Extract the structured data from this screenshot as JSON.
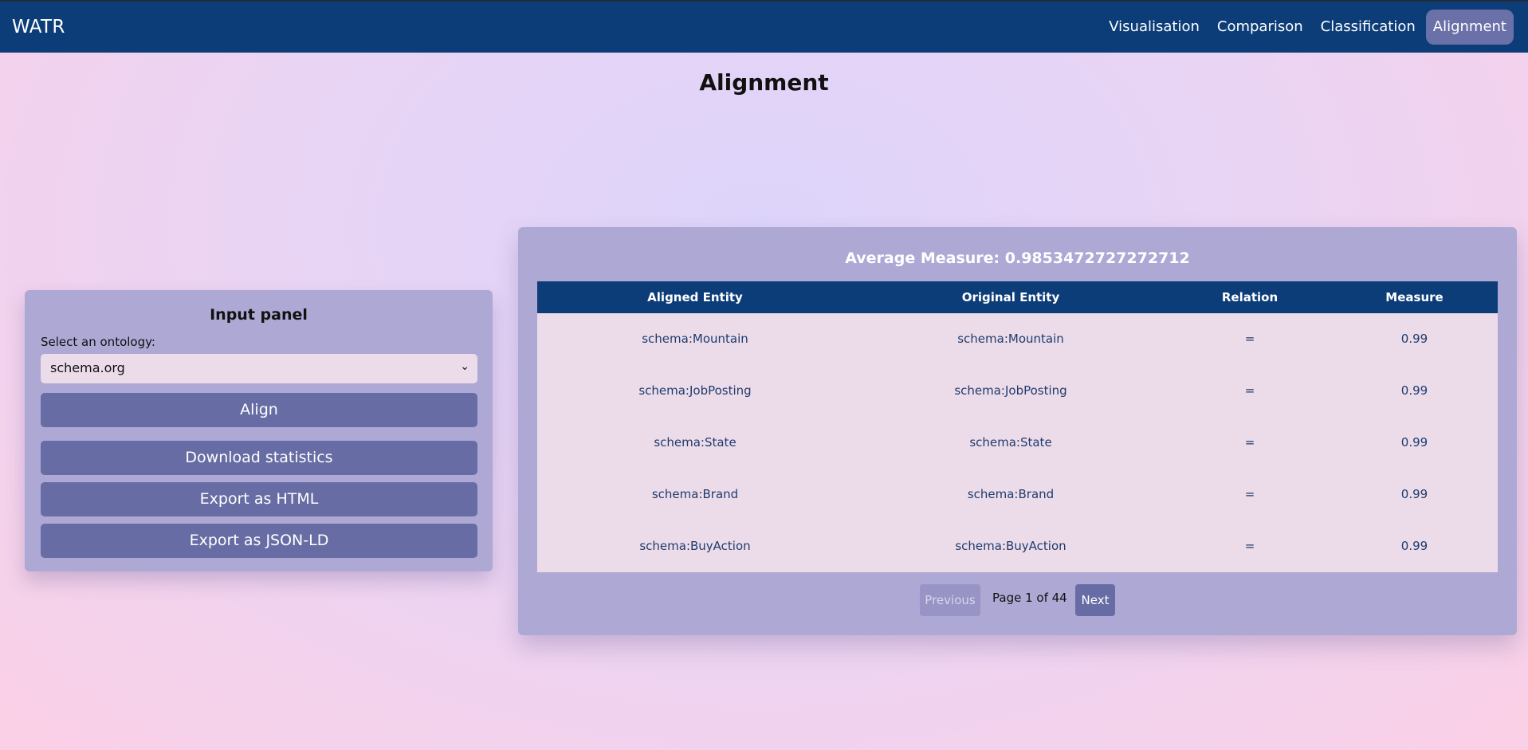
{
  "app": {
    "brand": "WATR"
  },
  "nav": {
    "items": [
      {
        "label": "Visualisation"
      },
      {
        "label": "Comparison"
      },
      {
        "label": "Classification"
      },
      {
        "label": "Alignment",
        "active": true
      }
    ]
  },
  "page": {
    "title": "Alignment"
  },
  "input_panel": {
    "title": "Input panel",
    "select_label": "Select an ontology:",
    "select_value": "schema.org",
    "align_label": "Align",
    "download_label": "Download statistics",
    "export_html_label": "Export as HTML",
    "export_jsonld_label": "Export as JSON-LD"
  },
  "results": {
    "average": "Average Measure: 0.9853472727272712",
    "columns": [
      "Aligned Entity",
      "Original Entity",
      "Relation",
      "Measure"
    ],
    "rows": [
      [
        "schema:Mountain",
        "schema:Mountain",
        "=",
        "0.99"
      ],
      [
        "schema:JobPosting",
        "schema:JobPosting",
        "=",
        "0.99"
      ],
      [
        "schema:State",
        "schema:State",
        "=",
        "0.99"
      ],
      [
        "schema:Brand",
        "schema:Brand",
        "=",
        "0.99"
      ],
      [
        "schema:BuyAction",
        "schema:BuyAction",
        "=",
        "0.99"
      ]
    ],
    "pagination": {
      "previous": "Previous",
      "info": "Page 1 of 44",
      "next": "Next"
    }
  },
  "colors": {
    "nav_bg": "#0c3d78",
    "panel_bg": "#aea8d5",
    "button_bg": "#676da4",
    "table_body": "#ecdcea"
  }
}
